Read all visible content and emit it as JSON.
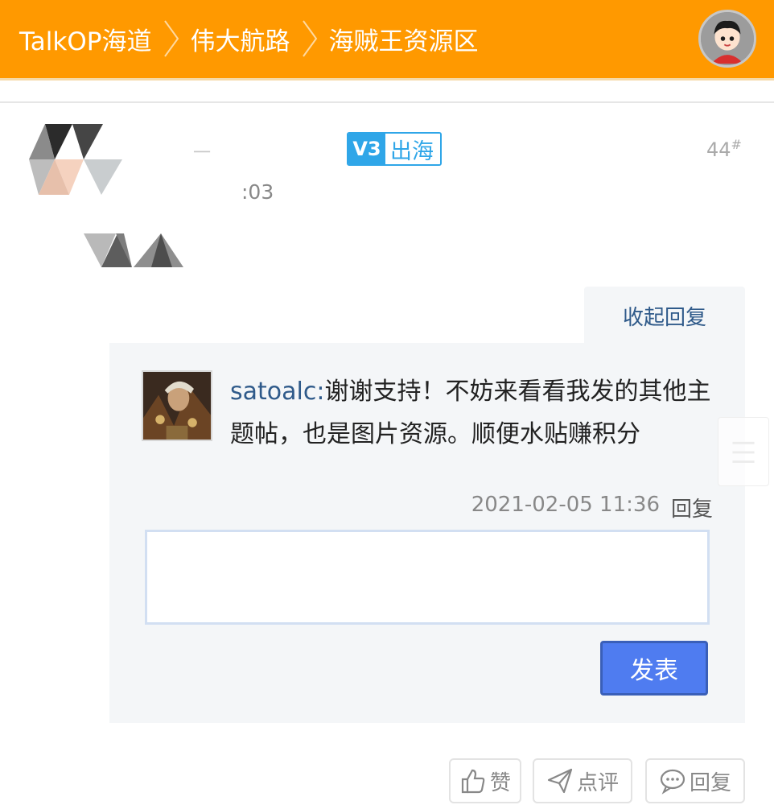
{
  "header": {
    "breadcrumbs": [
      "TalkOP海道",
      "伟大航路",
      "海贼王资源区"
    ],
    "avatar_icon": "user-avatar-icon",
    "background_color": "#ff9900"
  },
  "post": {
    "username": "一",
    "badge_level": "V3",
    "badge_text": "出海",
    "floor": "44",
    "floor_suffix": "#",
    "time": ":03"
  },
  "replies": {
    "collapse_label": "收起回复",
    "items": [
      {
        "author": "satoalc",
        "separator": ":",
        "text": "谢谢支持！不妨来看看我发的其他主题帖，也是图片资源。顺便水贴赚积分",
        "time": "2021-02-05 11:36",
        "reply_label": "回复"
      }
    ],
    "input_placeholder": "",
    "submit_label": "发表"
  },
  "actions": {
    "like_label": "赞",
    "comment_label": "点评",
    "reply_label": "回复"
  },
  "colors": {
    "accent": "#ff9900",
    "link": "#2f5a8a",
    "badge": "#2fa6e8",
    "button": "#4f7cf0"
  }
}
